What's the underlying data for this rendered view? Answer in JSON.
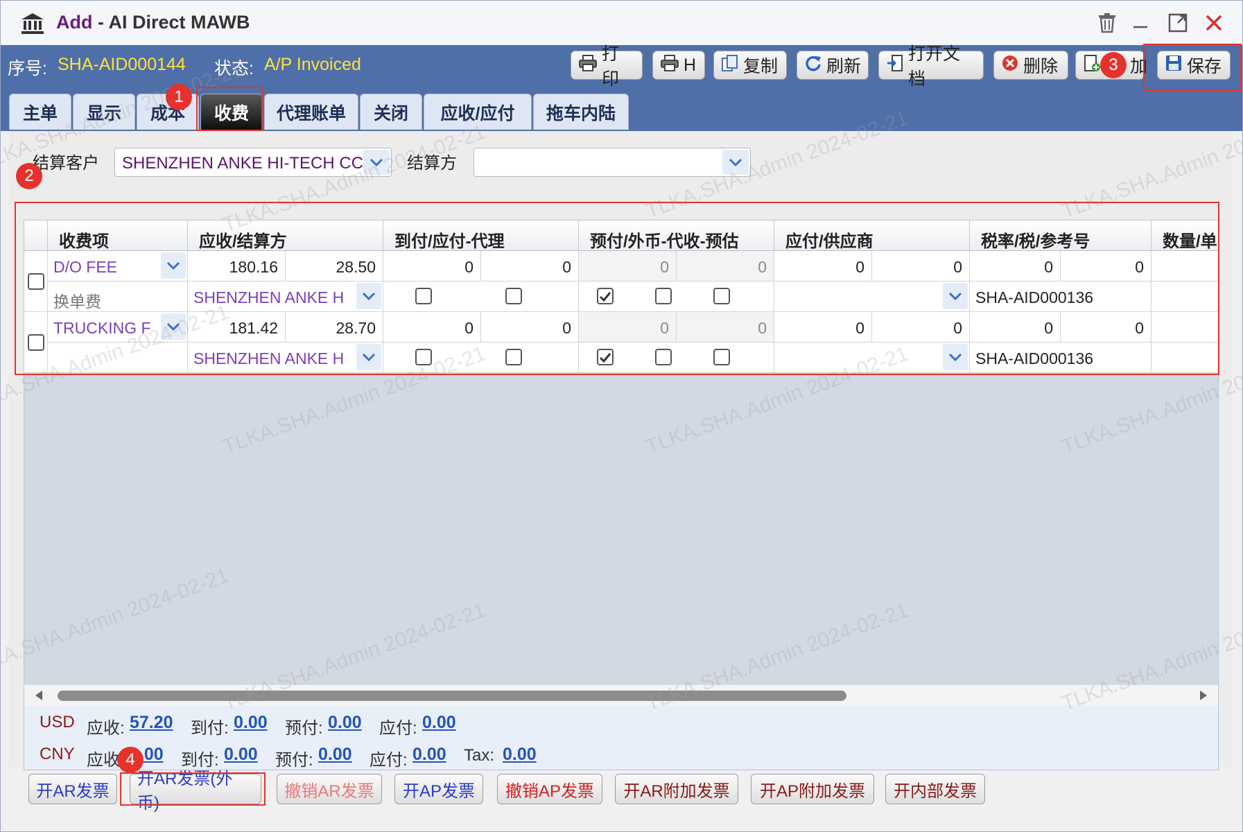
{
  "window": {
    "title_action": "Add",
    "title_separator": "-",
    "title_name": "AI Direct MAWB"
  },
  "info": {
    "seq_label": "序号:",
    "seq_value": "SHA-AID000144",
    "status_label": "状态:",
    "status_value": "A/P Invoiced"
  },
  "toolbar": {
    "print": "打印",
    "h": "H",
    "copy": "复制",
    "refresh": "刷新",
    "open_doc": "打开文档",
    "delete": "删除",
    "add": "加",
    "save": "保存"
  },
  "tabs": [
    "主单",
    "显示",
    "成本",
    "收费",
    "代理账单",
    "关闭",
    "应收/应付",
    "拖车内陆"
  ],
  "active_tab": "收费",
  "filters": {
    "customer_label": "结算客户",
    "customer_value": "SHENZHEN ANKE HI-TECH CC",
    "party_label": "结算方",
    "party_value": ""
  },
  "grid": {
    "headers": [
      "收费项",
      "应收/结算方",
      "到付/应付-代理",
      "预付/外币-代收-预估",
      "应付/供应商",
      "税率/税/参考号",
      "数量/单"
    ],
    "rows": [
      {
        "charge": "D/O FEE",
        "charge_desc": "换单费",
        "ar": "180.16",
        "ar2": "28.50",
        "cc1": "0",
        "cc2": "0",
        "pp1": "0",
        "pp2": "0",
        "ap1": "0",
        "ap2": "0",
        "tax1": "0",
        "tax2": "0",
        "party": "SHENZHEN ANKE H",
        "ref": "SHA-AID000136"
      },
      {
        "charge": "TRUCKING F",
        "charge_desc": "",
        "ar": "181.42",
        "ar2": "28.70",
        "cc1": "0",
        "cc2": "0",
        "pp1": "0",
        "pp2": "0",
        "ap1": "0",
        "ap2": "0",
        "tax1": "0",
        "tax2": "0",
        "party": "SHENZHEN ANKE H",
        "ref": "SHA-AID000136"
      }
    ]
  },
  "totals": {
    "usd": {
      "currency": "USD",
      "ar_label": "应收:",
      "ar": "57.20",
      "cc_label": "到付:",
      "cc": "0.00",
      "pp_label": "预付:",
      "pp": "0.00",
      "ap_label": "应付:",
      "ap": "0.00"
    },
    "cny": {
      "currency": "CNY",
      "ar_label": "应收",
      "ar": "0.00",
      "cc_label": "到付:",
      "cc": "0.00",
      "pp_label": "预付:",
      "pp": "0.00",
      "ap_label": "应付:",
      "ap": "0.00",
      "tax_label": "Tax:",
      "tax": "0.00"
    }
  },
  "actions": {
    "ar_invoice": "开AR发票",
    "ar_invoice_fc": "开AR发票(外币)",
    "cancel_ar": "撤销AR发票",
    "ap_invoice": "开AP发票",
    "cancel_ap": "撤销AP发票",
    "ar_extra": "开AR附加发票",
    "ap_extra": "开AP附加发票",
    "internal": "开内部发票"
  },
  "markers": [
    "1",
    "2",
    "3",
    "4"
  ],
  "watermark": "TLKA.SHA.Admin 2024-02-21",
  "colors": {
    "accent_bar": "#4f6fa8",
    "status_yellow": "#ffe23a",
    "marker_red": "#e5322d",
    "link_blue": "#2554b8"
  }
}
